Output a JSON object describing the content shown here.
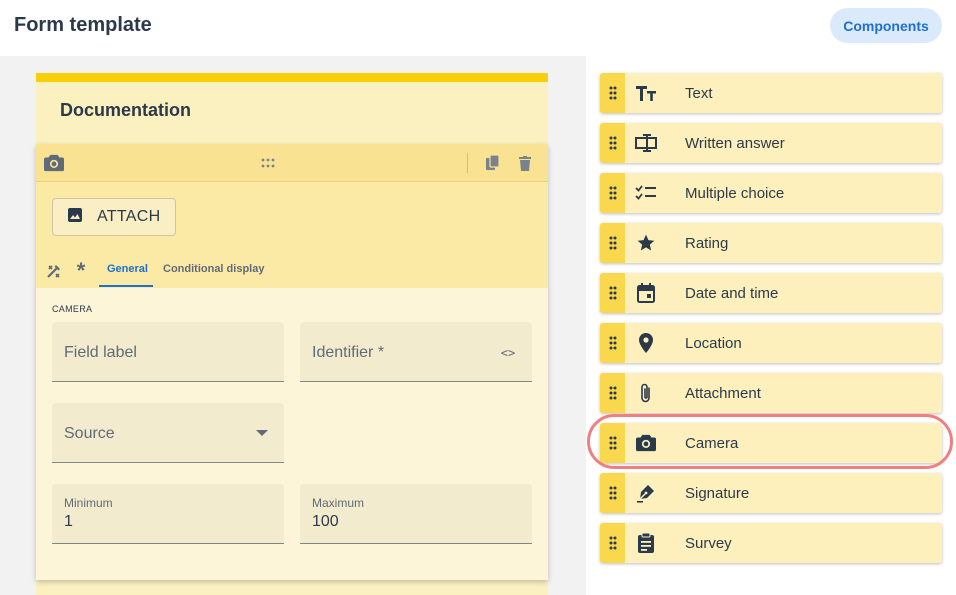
{
  "header": {
    "title": "Form template",
    "components_button": "Components"
  },
  "form": {
    "section_title": "Documentation",
    "field": {
      "attach_label": "ATTACH",
      "tabs": [
        {
          "label": "General",
          "active": true
        },
        {
          "label": "Conditional display",
          "active": false
        }
      ],
      "section_label": "CAMERA",
      "inputs": {
        "field_label": {
          "placeholder": "Field label"
        },
        "identifier": {
          "placeholder": "Identifier *"
        },
        "source": {
          "placeholder": "Source"
        },
        "minimum": {
          "label": "Minimum",
          "value": "1"
        },
        "maximum": {
          "label": "Maximum",
          "value": "100"
        }
      }
    }
  },
  "components": [
    {
      "label": "Text",
      "icon": "text-format-icon"
    },
    {
      "label": "Written answer",
      "icon": "text-input-icon"
    },
    {
      "label": "Multiple choice",
      "icon": "checklist-icon"
    },
    {
      "label": "Rating",
      "icon": "star-icon"
    },
    {
      "label": "Date and time",
      "icon": "calendar-icon"
    },
    {
      "label": "Location",
      "icon": "location-pin-icon"
    },
    {
      "label": "Attachment",
      "icon": "paperclip-icon"
    },
    {
      "label": "Camera",
      "icon": "camera-icon",
      "highlighted": true
    },
    {
      "label": "Signature",
      "icon": "pen-nib-icon"
    },
    {
      "label": "Survey",
      "icon": "clipboard-icon"
    }
  ],
  "colors": {
    "accent": "#1f6fd1",
    "card_yellow": "#fdf0bd",
    "handle_yellow": "#f9d84d",
    "highlight_ring": "#f08080"
  }
}
